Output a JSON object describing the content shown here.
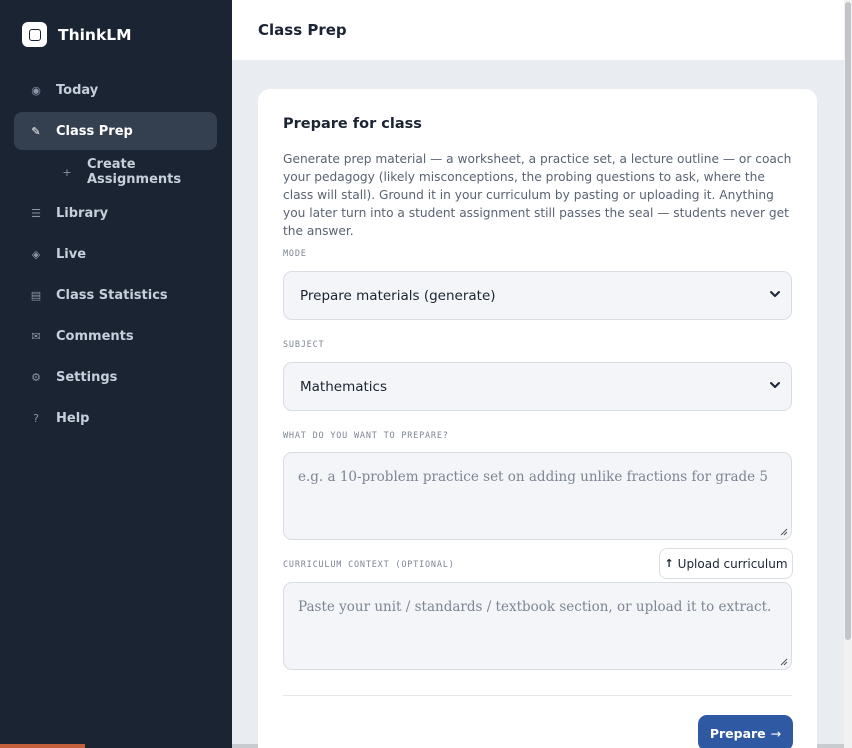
{
  "app": {
    "name": "ThinkLM"
  },
  "sidebar": {
    "items": [
      {
        "label": "Today",
        "icon": "circle-dot-icon",
        "glyph": "◉"
      },
      {
        "label": "Class Prep",
        "icon": "pencil-icon",
        "glyph": "✎",
        "active": true
      },
      {
        "label": "Create Assignments",
        "icon": "plus-icon",
        "glyph": "+",
        "sub": true
      },
      {
        "label": "Library",
        "icon": "list-icon",
        "glyph": "☰"
      },
      {
        "label": "Live",
        "icon": "diamond-icon",
        "glyph": "◈"
      },
      {
        "label": "Class Statistics",
        "icon": "chart-icon",
        "glyph": "▤"
      },
      {
        "label": "Comments",
        "icon": "mail-icon",
        "glyph": "✉"
      },
      {
        "label": "Settings",
        "icon": "gear-icon",
        "glyph": "⚙"
      },
      {
        "label": "Help",
        "icon": "help-icon",
        "glyph": "?"
      }
    ]
  },
  "header": {
    "title": "Class Prep"
  },
  "card": {
    "title": "Prepare for class",
    "description": "Generate prep material — a worksheet, a practice set, a lecture outline — or coach your pedagogy (likely misconceptions, the probing questions to ask, where the class will stall). Ground it in your curriculum by pasting or uploading it. Anything you later turn into a student assignment still passes the seal — students never get the answer."
  },
  "form": {
    "mode_label": "MODE",
    "mode_value": "Prepare materials (generate)",
    "subject_label": "SUBJECT",
    "subject_value": "Mathematics",
    "prepare_label": "WHAT DO YOU WANT TO PREPARE?",
    "prepare_placeholder": "e.g. a 10-problem practice set on adding unlike fractions for grade 5",
    "curriculum_label": "CURRICULUM CONTEXT (OPTIONAL)",
    "curriculum_placeholder": "Paste your unit / standards / textbook section, or upload it to extract.",
    "upload_label": "Upload curriculum",
    "submit_label": "Prepare",
    "submit_arrow": "→"
  },
  "colors": {
    "sidebar": "#1b2433",
    "accent": "#2f5aa3",
    "background": "#e9ecf0"
  }
}
